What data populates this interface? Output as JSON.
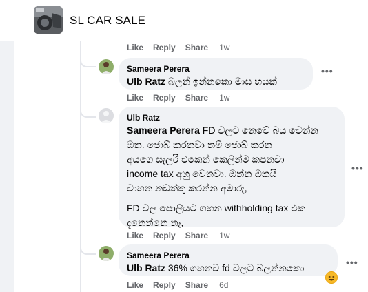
{
  "header": {
    "group_name": "SL CAR SALE"
  },
  "actions": {
    "like": "Like",
    "reply": "Reply",
    "share": "Share"
  },
  "comments": [
    {
      "author": "Sameera Perera",
      "mention": "Ulb Ratz",
      "body": " බලන් ඉන්නකො මාස හයක්",
      "time": "1w"
    },
    {
      "author": "Ulb Ratz",
      "mention": "Sameera Perera",
      "lines": [
        " FD වලට නෙවේ බය වෙන්න",
        "ඔන. ජොබ් කරනවා නම් ජොබ් කරන",
        "අයගෙ සැලරි එකෙන් කෙලින්ම කපනවා",
        "income tax අහු වෙනවා. ඔන්න ඔකයි",
        "වාහන නඩත්තු කරන්න අමාරු,"
      ],
      "para2": [
        "FD වල පොලියට ගහන withholding tax එක",
        "දැනෙන්නෙ නෑ,"
      ],
      "time": "1w"
    },
    {
      "author": "Sameera Perera",
      "mention": "Ulb Ratz",
      "body": " 36% ගහනව fd වලට බලන්නකො",
      "time": "6d",
      "reaction_icon": "laughing-emoji-icon"
    }
  ],
  "top_action_time": "1w",
  "colors": {
    "bubble": "#f0f2f5",
    "meta": "#65676b",
    "reaction": "#f7b928"
  }
}
